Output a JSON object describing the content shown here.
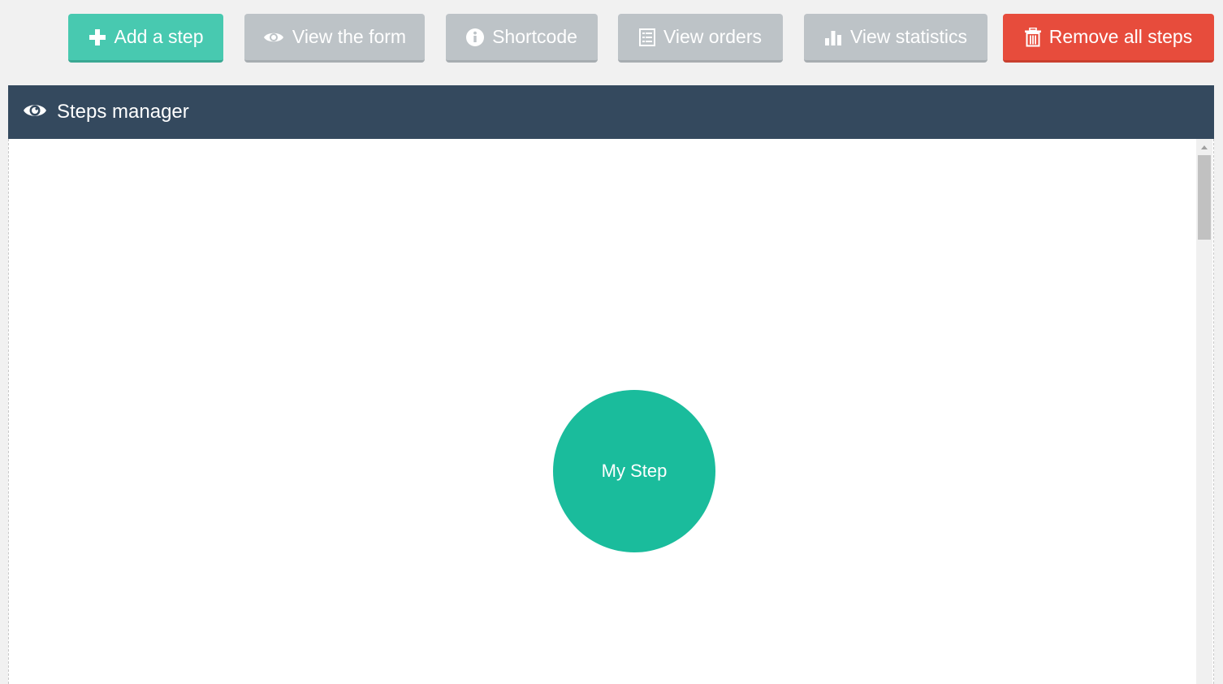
{
  "toolbar": {
    "add_step": {
      "label": "Add a step",
      "icon": "plus-icon"
    },
    "view_form": {
      "label": "View the form",
      "icon": "eye-icon"
    },
    "shortcode": {
      "label": "Shortcode",
      "icon": "info-icon"
    },
    "view_orders": {
      "label": "View orders",
      "icon": "list-icon"
    },
    "view_statistics": {
      "label": "View statistics",
      "icon": "bar-chart-icon"
    },
    "remove_all": {
      "label": "Remove all steps",
      "icon": "trash-icon"
    }
  },
  "panel": {
    "title": "Steps manager",
    "icon": "eye-icon"
  },
  "steps": [
    {
      "label": "My Step"
    }
  ],
  "colors": {
    "accent_green": "#48c9b0",
    "step_green": "#1abc9c",
    "neutral_grey": "#bdc3c7",
    "danger_red": "#e74c3c",
    "header_navy": "#34495e"
  }
}
